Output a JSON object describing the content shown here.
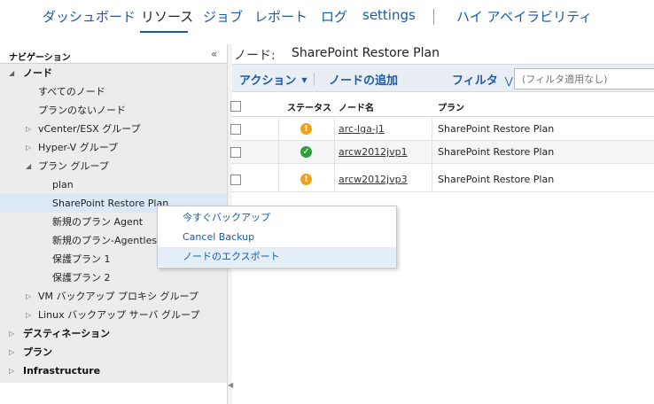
{
  "topnav": {
    "items": [
      "ダッシュボード",
      "リソース",
      "ジョブ",
      "レポート",
      "ログ",
      "settings",
      "ハイ アベイラビリティ"
    ],
    "active": "リソース"
  },
  "nav": {
    "title": "ナビゲーション",
    "collapse_icon": "double-chevron-left-icon",
    "tree": [
      {
        "label": "ノード",
        "expanded": true,
        "bold": true
      },
      {
        "label": "すべてのノード"
      },
      {
        "label": "プランのないノード"
      },
      {
        "label": "vCenter/ESX グループ",
        "expanded": false
      },
      {
        "label": "Hyper-V グループ",
        "expanded": false
      },
      {
        "label": "プラン グループ",
        "expanded": true
      },
      {
        "label": "plan"
      },
      {
        "label": "SharePoint Restore Plan",
        "selected": true
      },
      {
        "label": "新規のプラン Agent"
      },
      {
        "label": "新規のプラン-Agentless"
      },
      {
        "label": "保護プラン 1"
      },
      {
        "label": "保護プラン 2"
      },
      {
        "label": "VM バックアップ プロキシ グループ",
        "expanded": false
      },
      {
        "label": "Linux バックアップ サーバ グループ",
        "expanded": false
      },
      {
        "label": "デスティネーション",
        "expanded": false,
        "bold": true
      },
      {
        "label": "プラン",
        "expanded": false,
        "bold": true
      },
      {
        "label": "Infrastructure",
        "expanded": false,
        "bold": true
      }
    ]
  },
  "main": {
    "node_label": "ノード:",
    "plan_name": "SharePoint Restore Plan",
    "toolbar": {
      "action_label": "アクション",
      "add_node_label": "ノードの追加",
      "filter_label": "フィルタ",
      "filter_placeholder": "(フィルタ適用なし)"
    },
    "table": {
      "columns": [
        "ステータス",
        "ノード名",
        "プラン"
      ],
      "rows": [
        {
          "status": "warning",
          "node": "arc-lga-j1",
          "plan": "SharePoint Restore Plan"
        },
        {
          "status": "ok",
          "node": "arcw2012jvp1",
          "plan": "SharePoint Restore Plan"
        },
        {
          "status": "warning",
          "node": "arcw2012jvp3",
          "plan": "SharePoint Restore Plan"
        }
      ]
    }
  },
  "context_menu": {
    "items": [
      "今すぐバックアップ",
      "Cancel Backup",
      "ノードのエクスポート"
    ],
    "highlighted": "ノードのエクスポート"
  },
  "colors": {
    "accent": "#1a5aa6",
    "warning": "#f0a01a",
    "ok": "#2e9e3e",
    "selected_row": "#dbe9f7"
  }
}
